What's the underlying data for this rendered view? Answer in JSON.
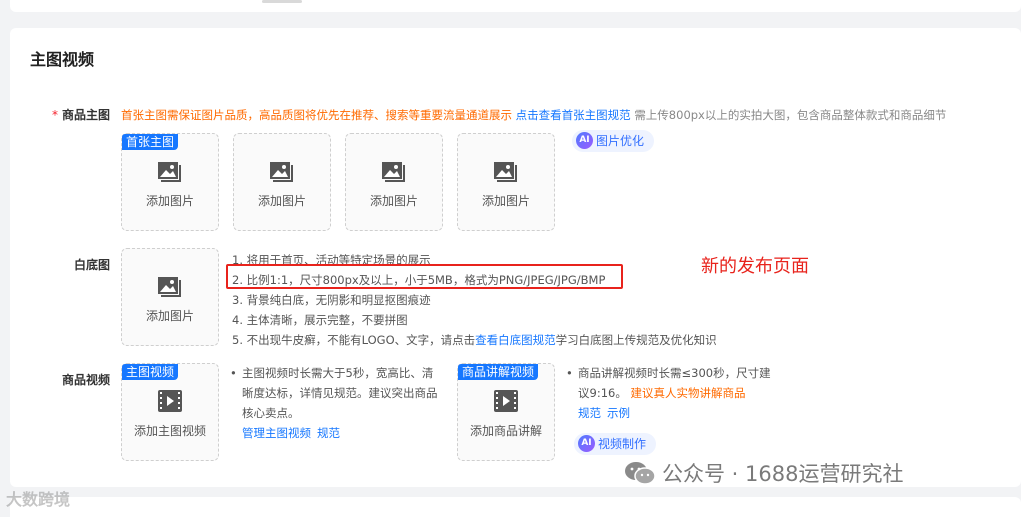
{
  "section": {
    "title": "主图视频"
  },
  "main_image": {
    "required_mark": "*",
    "label": "商品主图",
    "hint_orange": "首张主图需保证图片品质，高品质图将优先在推荐、搜索等重要流量通道展示",
    "hint_link": "点击查看首张主图规范",
    "hint_grey": "需上传800px以上的实拍大图，包含商品整体款式和商品细节",
    "first_tag": "首张主图",
    "slot_label": "添加图片",
    "ai_badge": "AI",
    "ai_button": "图片优化"
  },
  "white_bg": {
    "label": "白底图",
    "slot_label": "添加图片",
    "rules": [
      "1. 将用于首页、活动等特定场景的展示",
      "2. 比例1:1，尺寸800px及以上，小于5MB，格式为PNG/JPEG/JPG/BMP",
      "3. 背景纯白底，无阴影和明显抠图痕迹",
      "4. 主体清晰，展示完整，不要拼图"
    ],
    "rule5_prefix": "5. 不出现牛皮癣，不能有LOGO、文字，请点击",
    "rule5_link": "查看白底图规范",
    "rule5_suffix": "学习白底图上传规范及优化知识"
  },
  "annotation": "新的发布页面",
  "video": {
    "label": "商品视频",
    "main_tag": "主图视频",
    "main_slot_label": "添加主图视频",
    "main_desc_lines": [
      "主图视频时长需大于5秒，宽高比、清",
      "晰度达标，详情见规范。建议突出商品",
      "核心卖点。"
    ],
    "main_links": [
      "管理主图视频",
      "规范"
    ],
    "explain_tag": "商品讲解视频",
    "explain_slot_label": "添加商品讲解",
    "explain_desc_line1": "商品讲解视频时长需≤300秒，尺寸建",
    "explain_desc_line2_prefix": "议9:16。",
    "explain_desc_line2_orange": "建议真人实物讲解商品",
    "explain_links": [
      "规范",
      "示例"
    ],
    "ai_badge": "AI",
    "ai_button": "视频制作"
  },
  "watermarks": {
    "right": "公众号 · 1688运营研究社",
    "left": "大数跨境"
  }
}
